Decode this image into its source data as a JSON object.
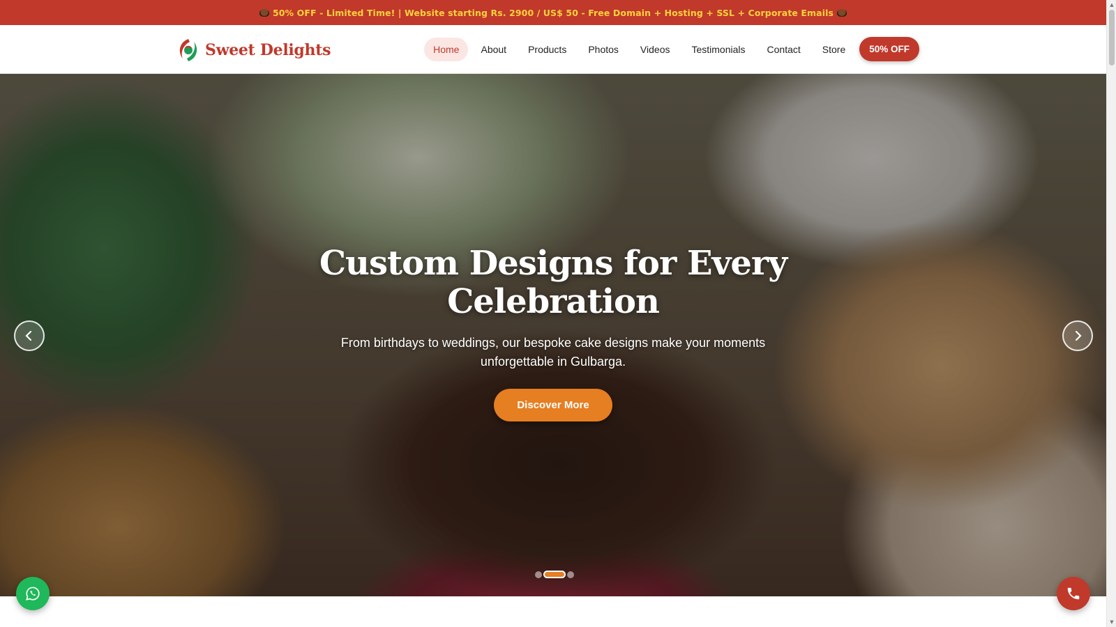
{
  "promo": {
    "text": "50% OFF - Limited Time! | Website starting Rs. 2900 / US$ 50 - Free Domain + Hosting + SSL + Corporate Emails"
  },
  "header": {
    "brand": "Sweet Delights",
    "nav": {
      "home": "Home",
      "about": "About",
      "products": "Products",
      "photos": "Photos",
      "videos": "Videos",
      "testimonials": "Testimonials",
      "contact": "Contact",
      "store": "Store"
    },
    "cta": "50% OFF"
  },
  "hero": {
    "title": "Custom Designs for Every Celebration",
    "subtitle": "From birthdays to weddings, our bespoke cake designs make your moments unforgettable in Gulbarga.",
    "button": "Discover More",
    "slides": {
      "count": 3,
      "active": 2
    }
  },
  "icons": {
    "left": "chevron-left-icon",
    "right": "chevron-right-icon",
    "whatsapp": "whatsapp-icon",
    "phone": "phone-icon"
  },
  "colors": {
    "brand_red": "#c0392b",
    "accent_orange": "#e67e22",
    "promo_text": "#ffd23c",
    "whatsapp_green": "#1fb85a"
  }
}
